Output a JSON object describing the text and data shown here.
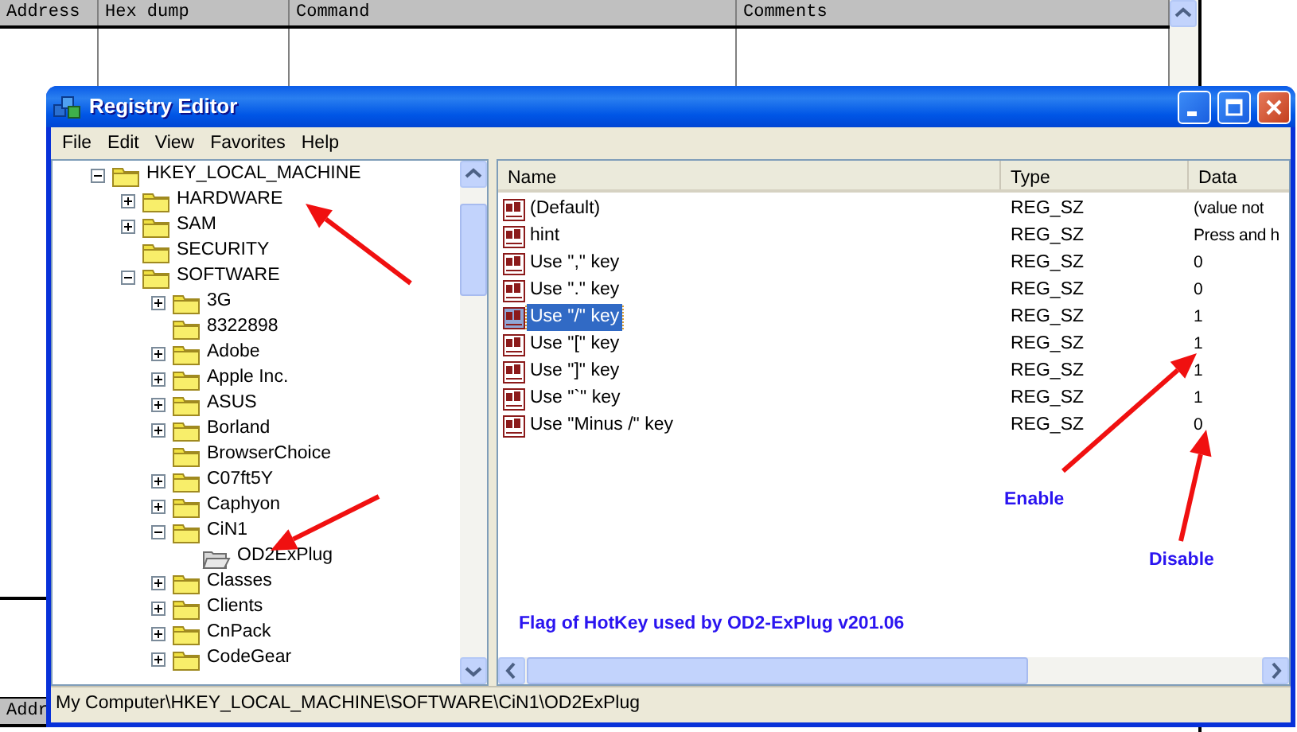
{
  "background_window": {
    "columns": [
      "Address",
      "Hex dump",
      "Command",
      "Comments"
    ],
    "lower_pane": {
      "columns": [
        "Addr"
      ]
    }
  },
  "window": {
    "title": "Registry Editor"
  },
  "menu": [
    "File",
    "Edit",
    "View",
    "Favorites",
    "Help"
  ],
  "tree": [
    {
      "label": "HKEY_LOCAL_MACHINE",
      "expanded": true,
      "selected": false,
      "children": [
        {
          "label": "HARDWARE",
          "expanded": false,
          "selected": false
        },
        {
          "label": "SAM",
          "expanded": false,
          "selected": false
        },
        {
          "label": "SECURITY",
          "selected": false
        },
        {
          "label": "SOFTWARE",
          "expanded": true,
          "selected": false,
          "children": [
            {
              "label": "3G",
              "expanded": false,
              "selected": false
            },
            {
              "label": "8322898",
              "selected": false
            },
            {
              "label": "Adobe",
              "expanded": false,
              "selected": false
            },
            {
              "label": "Apple Inc.",
              "expanded": false,
              "selected": false
            },
            {
              "label": "ASUS",
              "expanded": false,
              "selected": false
            },
            {
              "label": "Borland",
              "expanded": false,
              "selected": false
            },
            {
              "label": "BrowserChoice",
              "selected": false
            },
            {
              "label": "C07ft5Y",
              "expanded": false,
              "selected": false
            },
            {
              "label": "Caphyon",
              "expanded": false,
              "selected": false
            },
            {
              "label": "CiN1",
              "expanded": true,
              "selected": false,
              "children": [
                {
                  "label": "OD2ExPlug",
                  "selected": true
                }
              ]
            },
            {
              "label": "Classes",
              "expanded": false,
              "selected": false
            },
            {
              "label": "Clients",
              "expanded": false,
              "selected": false
            },
            {
              "label": "CnPack",
              "expanded": false,
              "selected": false
            },
            {
              "label": "CodeGear",
              "expanded": false,
              "selected": false
            }
          ]
        }
      ]
    }
  ],
  "values": {
    "columns": [
      "Name",
      "Type",
      "Data"
    ],
    "rows": [
      {
        "name": "(Default)",
        "type": "REG_SZ",
        "data": "(value not",
        "selected": false
      },
      {
        "name": "hint",
        "type": "REG_SZ",
        "data": "Press and h",
        "selected": false
      },
      {
        "name": "Use \",\" key",
        "type": "REG_SZ",
        "data": "0",
        "selected": false
      },
      {
        "name": "Use \".\" key",
        "type": "REG_SZ",
        "data": "0",
        "selected": false
      },
      {
        "name": "Use \"/\" key",
        "type": "REG_SZ",
        "data": "1",
        "selected": true
      },
      {
        "name": "Use \"[\" key",
        "type": "REG_SZ",
        "data": "1",
        "selected": false
      },
      {
        "name": "Use \"]\" key",
        "type": "REG_SZ",
        "data": "1",
        "selected": false
      },
      {
        "name": "Use \"`\" key",
        "type": "REG_SZ",
        "data": "1",
        "selected": false
      },
      {
        "name": "Use \"Minus /\" key",
        "type": "REG_SZ",
        "data": "0",
        "selected": false
      }
    ]
  },
  "annotations": [
    "Enable",
    "Disable",
    "Flag of HotKey used by OD2-ExPlug v201.06"
  ],
  "status_bar": "My Computer\\HKEY_LOCAL_MACHINE\\SOFTWARE\\CiN1\\OD2ExPlug"
}
